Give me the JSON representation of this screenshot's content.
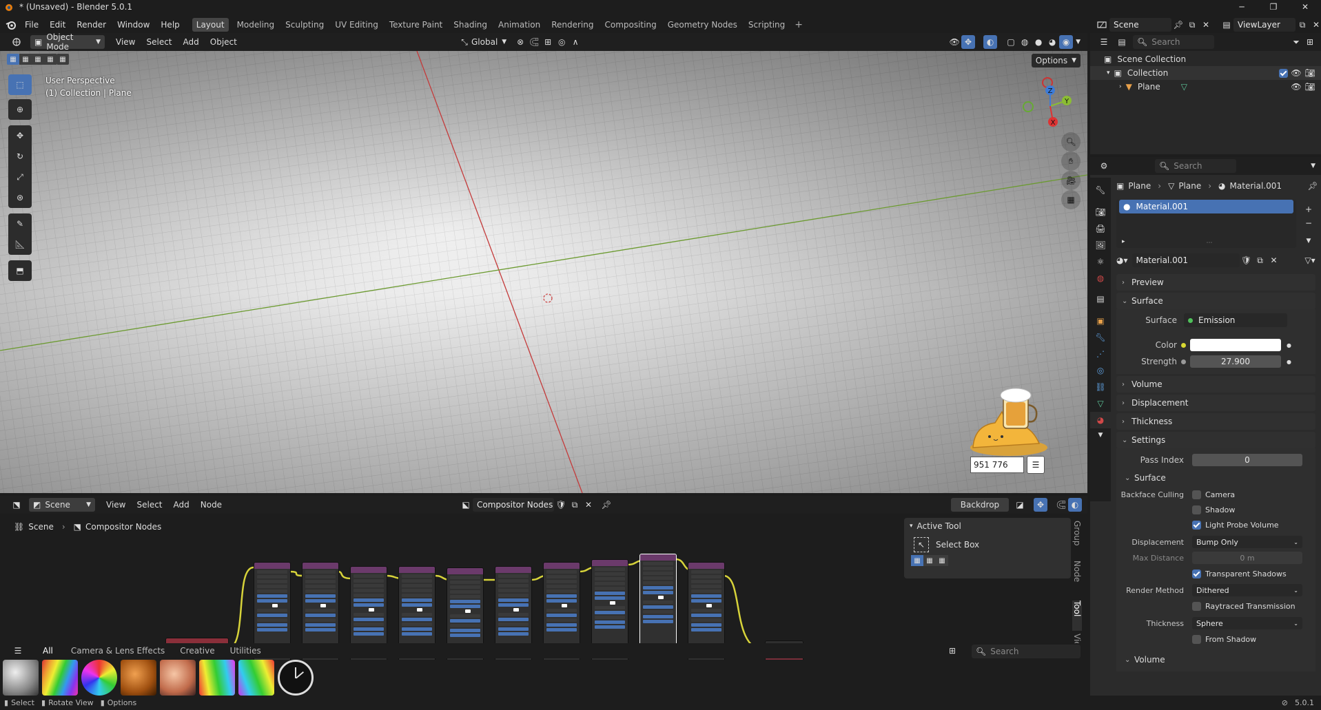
{
  "window": {
    "title": "* (Unsaved) - Blender 5.0.1"
  },
  "topmenu": [
    "File",
    "Edit",
    "Render",
    "Window",
    "Help"
  ],
  "workspaces": [
    "Layout",
    "Modeling",
    "Sculpting",
    "UV Editing",
    "Texture Paint",
    "Shading",
    "Animation",
    "Rendering",
    "Compositing",
    "Geometry Nodes",
    "Scripting"
  ],
  "scene": {
    "name": "Scene",
    "viewlayer": "ViewLayer"
  },
  "viewport": {
    "mode": "Object Mode",
    "menus": [
      "View",
      "Select",
      "Add",
      "Object"
    ],
    "orientation": "Global",
    "options": "Options",
    "perspective": "User Perspective",
    "collection_info": "(1) Collection | Plane",
    "counter": "951 776",
    "gizmo": {
      "x": "X",
      "y": "Y",
      "z": "Z"
    }
  },
  "outliner": {
    "search_placeholder": "Search",
    "scene_collection": "Scene Collection",
    "collection": "Collection",
    "plane": "Plane"
  },
  "properties": {
    "search_placeholder": "Search",
    "breadcrumb": [
      "Plane",
      "Plane",
      "Material.001"
    ],
    "material_slot": "Material.001",
    "material_name": "Material.001",
    "sections": {
      "preview": "Preview",
      "surface": "Surface",
      "volume": "Volume",
      "displacement": "Displacement",
      "thickness": "Thickness",
      "settings": "Settings",
      "surface_sub": "Surface",
      "volume_sub": "Volume"
    },
    "surface_label": "Surface",
    "surface_value": "Emission",
    "color_label": "Color",
    "strength_label": "Strength",
    "strength_value": "27.900",
    "pass_index_label": "Pass Index",
    "pass_index_value": "0",
    "backface_culling_label": "Backface Culling",
    "camera_label": "Camera",
    "shadow_label": "Shadow",
    "light_probe_label": "Light Probe Volume",
    "displacement_label": "Displacement",
    "displacement_value": "Bump Only",
    "max_distance_label": "Max Distance",
    "max_distance_value": "0 m",
    "transparent_shadows_label": "Transparent Shadows",
    "render_method_label": "Render Method",
    "render_method_value": "Dithered",
    "raytraced_label": "Raytraced Transmission",
    "thickness_label": "Thickness",
    "thickness_value": "Sphere",
    "from_shadow_label": "From Shadow",
    "colors": {
      "emission_dot": "#4fc05a",
      "color_dot": "#d8d832"
    }
  },
  "compositor": {
    "scene": "Scene",
    "menus": [
      "View",
      "Select",
      "Add",
      "Node"
    ],
    "tree_name": "Compositor Nodes",
    "backdrop": "Backdrop",
    "breadcrumb_scene": "Scene",
    "breadcrumb_tree": "Compositor Nodes",
    "active_tool_title": "Active Tool",
    "select_box": "Select Box",
    "side_tabs": [
      "Group",
      "Node",
      "Tool",
      "View"
    ]
  },
  "asset_shelf": {
    "tabs": [
      "All",
      "Camera & Lens Effects",
      "Creative",
      "Utilities"
    ],
    "search_placeholder": "Search"
  },
  "statusbar": {
    "items": [
      "Select",
      "Rotate View",
      "Options"
    ],
    "version": "5.0.1"
  }
}
